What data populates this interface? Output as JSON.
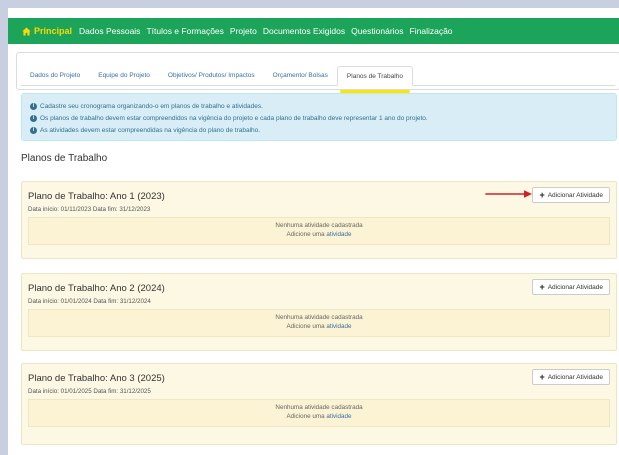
{
  "nav": {
    "home": "Principal",
    "items": [
      "Dados Pessoais",
      "Títulos e Formações",
      "Projeto",
      "Documentos Exigidos",
      "Questionários",
      "Finalização"
    ]
  },
  "tabs": [
    "Dados do Projeto",
    "Equipe do Projeto",
    "Objetivos/ Produtos/ Impactos",
    "Orçamento/ Bolsas",
    "Planos de Trabalho"
  ],
  "active_tab": "Planos de Trabalho",
  "info": [
    "Cadastre seu cronograma organizando-o em planos de trabalho e atividades.",
    "Os planos de trabalho devem estar compreendidos na vigência do projeto e cada plano de trabalho deve representar 1 ano do projeto.",
    "As atividades devem estar compreendidas na vigência do plano de trabalho."
  ],
  "section_title": "Planos de Trabalho",
  "plans": [
    {
      "title": "Plano de Trabalho: Ano 1 (2023)",
      "dates": "Data início: 01/11/2023 Data fim: 31/12/2023"
    },
    {
      "title": "Plano de Trabalho: Ano 2 (2024)",
      "dates": "Data início: 01/01/2024 Data fim: 31/12/2024"
    },
    {
      "title": "Plano de Trabalho: Ano 3 (2025)",
      "dates": "Data início: 01/01/2025 Data fim: 31/12/2025"
    }
  ],
  "add_button": "Adicionar Atividade",
  "empty": {
    "line1": "Nenhuma atividade cadastrada",
    "line2_prefix": "Adicione uma ",
    "line2_link": "atividade"
  },
  "colors": {
    "nav_bg": "#1ca45b",
    "home": "#ffd800",
    "highlight": "#ffe600",
    "arrow": "#d0202a",
    "info_bg": "#d9edf7",
    "plan_bg": "#fcf8e3"
  }
}
